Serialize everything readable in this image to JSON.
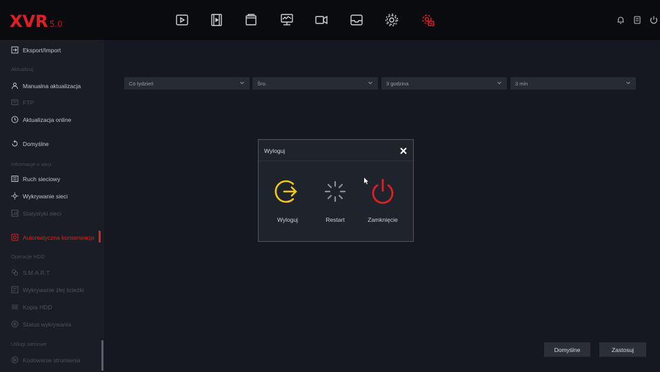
{
  "app": {
    "logo": "XVR",
    "version": "5.0"
  },
  "topbar": {
    "icons": [
      "playback-icon",
      "video-clip-icon",
      "files-icon",
      "monitor-icon",
      "camera-icon",
      "storage-icon",
      "settings-icon",
      "maintenance-icon"
    ],
    "right_icons": [
      "bell-icon",
      "printer-icon",
      "power-icon"
    ],
    "active_color": "#e01e24"
  },
  "sidebar": {
    "items": [
      {
        "label": "Eksport/Import",
        "icon": "import-export-icon"
      },
      {
        "group": "Aktualizuj"
      },
      {
        "label": "Manualna aktualizacja",
        "icon": "manual-update-icon"
      },
      {
        "label": "FTP",
        "icon": "ftp-icon"
      },
      {
        "label": "Aktualizacja online",
        "icon": "online-update-icon"
      },
      {
        "label": "Domyślne",
        "icon": "default-icon"
      },
      {
        "group": "Informacje o sieci"
      },
      {
        "label": "Ruch sieciowy",
        "icon": "network-traffic-icon"
      },
      {
        "label": "Wykrywanie sieci",
        "icon": "network-detect-icon"
      },
      {
        "label": "Statystyki sieci",
        "icon": "network-stats-icon"
      },
      {
        "label": "Automatyczna konserwacja",
        "icon": "auto-maintenance-icon"
      },
      {
        "group": "Operacje HDD"
      },
      {
        "label": "S.M.A.R.T",
        "icon": "smart-icon"
      },
      {
        "label": "Wykrywanie złej ścieżki",
        "icon": "bad-track-icon"
      },
      {
        "label": "Kopia HDD",
        "icon": "hdd-copy-icon"
      },
      {
        "label": "Status wykrywania",
        "icon": "detect-status-icon"
      },
      {
        "group": "Usługi sieciowe"
      },
      {
        "label": "Kodowanie strumienia",
        "icon": "stream-encoding-icon"
      }
    ]
  },
  "schedule": {
    "frequency": "Co tydzień",
    "day": "Śro.",
    "hour": "3 godzina",
    "minute": "3 min"
  },
  "dialog": {
    "title": "Wyloguj",
    "options": [
      {
        "label": "Wyloguj",
        "icon": "logout-icon",
        "color": "#f5c518"
      },
      {
        "label": "Restart",
        "icon": "restart-icon",
        "color": "#8a8e96"
      },
      {
        "label": "Zamknięcie",
        "icon": "shutdown-icon",
        "color": "#e01e24"
      }
    ]
  },
  "buttons": {
    "default": "Domyślne",
    "apply": "Zastosuj"
  }
}
